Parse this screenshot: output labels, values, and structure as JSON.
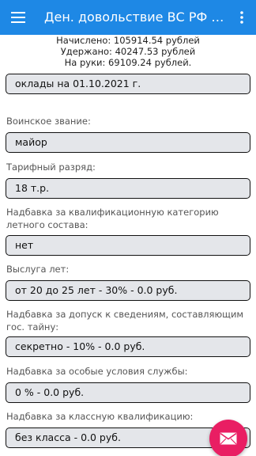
{
  "appbar": {
    "title": "Ден. довольствие ВС РФ 2...",
    "color": "#1e88e5",
    "menu_icon": "hamburger-menu-icon",
    "overflow_icon": "more-vert-icon"
  },
  "summary": {
    "accrued": "Начислено: 105914.54 рублей",
    "withheld": "Удержано: 40247.53 рублей",
    "net": "На руки: 69109.24 рублей."
  },
  "salary_date": "оклады на 01.10.2021 г.",
  "fields": [
    {
      "label": "Воинское звание:",
      "value": "майор"
    },
    {
      "label": "Тарифный разряд:",
      "value": "18 т.р."
    },
    {
      "label": "Надбавка за квалификационную категорию летного состава:",
      "value": "нет"
    },
    {
      "label": "Выслуга лет:",
      "value": "от 20 до 25 лет - 30% - 0.0 руб."
    },
    {
      "label": "Надбавка за допуск к сведениям, составляющим гос. тайну:",
      "value": "секретно - 10% - 0.0 руб."
    },
    {
      "label": "Надбавка за особые условия службы:",
      "value": "0 % - 0.0 руб."
    },
    {
      "label": "Надбавка за классную квалификацию:",
      "value": "без класса - 0.0 руб."
    }
  ],
  "fab": {
    "icon": "mail-icon",
    "color": "#e91e63"
  }
}
